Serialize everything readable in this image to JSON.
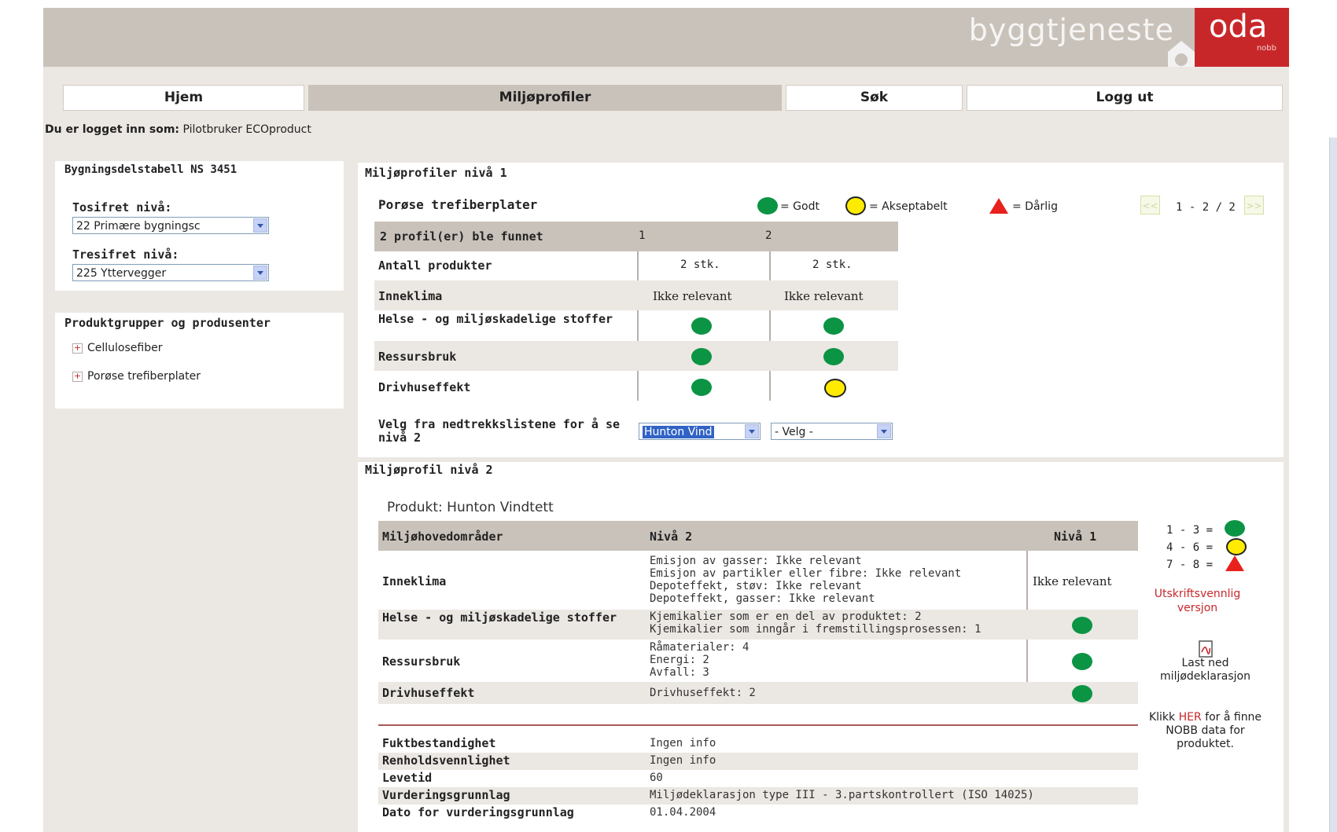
{
  "header": {
    "brand_text": "byggtjeneste",
    "logo_main": "oda",
    "logo_sub": "nobb"
  },
  "nav": {
    "items": [
      "Hjem",
      "Miljøprofiler",
      "Søk",
      "Logg ut"
    ]
  },
  "login": {
    "label": "Du er logget inn som:",
    "user": "Pilotbruker ECOproduct"
  },
  "left": {
    "ns_title": "Bygningsdelstabell NS 3451",
    "tosifret_label": "Tosifret nivå:",
    "tosifret_value": "22 Primære bygningsc",
    "tresifret_label": "Tresifret nivå:",
    "tresifret_value": "225 Yttervegger",
    "produkt_title": "Produktgrupper og produsenter",
    "groups": [
      "Cellulosefiber",
      "Porøse trefiberplater"
    ]
  },
  "level1": {
    "title": "Miljøprofiler nivå 1",
    "group_name": "Porøse trefiberplater",
    "legend": {
      "good": "= Godt",
      "ok": "= Akseptabelt",
      "bad": "= Dårlig"
    },
    "pagination": {
      "prev": "<<",
      "text": "1 - 2 / 2",
      "next": ">>"
    },
    "table": {
      "header": [
        "2 profil(er) ble funnet",
        "1",
        "2"
      ],
      "rows": [
        {
          "label": "Antall produkter",
          "c1": "2 stk.",
          "c2": "2 stk."
        },
        {
          "label": "Inneklima",
          "c1": "Ikke relevant",
          "c2": "Ikke relevant"
        },
        {
          "label": "Helse - og miljøskadelige stoffer",
          "c1": "green",
          "c2": "green"
        },
        {
          "label": "Ressursbruk",
          "c1": "green",
          "c2": "green"
        },
        {
          "label": "Drivhuseffekt",
          "c1": "green",
          "c2": "yellow"
        }
      ]
    },
    "select_label": "Velg fra nedtrekkslistene for å se nivå 2",
    "select1": "Hunton Vind",
    "select2": "- Velg -"
  },
  "level2": {
    "title": "Miljøprofil nivå 2",
    "product": "Produkt: Hunton Vindtett",
    "table": {
      "header": [
        "Miljøhovedområder",
        "Nivå 2",
        "Nivå 1"
      ],
      "rows": [
        {
          "label": "Inneklima",
          "details": [
            "Emisjon av gasser: Ikke relevant",
            "Emisjon av partikler eller fibre: Ikke relevant",
            "Depoteffekt, støv: Ikke relevant",
            "Depoteffekt, gasser: Ikke relevant"
          ],
          "level1": "Ikke relevant"
        },
        {
          "label": "Helse - og miljøskadelige stoffer",
          "details": [
            "Kjemikalier som er en del av produktet: 2",
            "Kjemikalier som inngår i fremstillingsprosessen: 1"
          ],
          "level1": "green"
        },
        {
          "label": "Ressursbruk",
          "details": [
            "Råmaterialer: 4",
            "Energi: 2",
            "Avfall: 3"
          ],
          "level1": "green"
        },
        {
          "label": "Drivhuseffekt",
          "details": [
            "Drivhuseffekt: 2"
          ],
          "level1": "green"
        }
      ]
    },
    "extra": [
      {
        "label": "Fuktbestandighet",
        "value": "Ingen info"
      },
      {
        "label": "Renholdsvennlighet",
        "value": "Ingen info"
      },
      {
        "label": "Levetid",
        "value": "60"
      },
      {
        "label": "Vurderingsgrunnlag",
        "value": "Miljødeklarasjon type III - 3.partskontrollert (ISO 14025)"
      },
      {
        "label": "Dato for vurderingsgrunnlag",
        "value": "01.04.2004"
      }
    ],
    "side": {
      "scale1": "1 - 3 =",
      "scale2": "4 - 6 =",
      "scale3": "7 - 8 =",
      "print_link": "Utskriftsvennlig versjon",
      "download_line1": "Last ned",
      "download_line2": "miljødeklarasjon",
      "klikk": "Klikk",
      "her": "HER",
      "klikk_rest": "for å finne NOBB data for produktet."
    }
  },
  "colors": {
    "green": "#0b9444",
    "yellow": "#ffeb00",
    "red": "#e8211d",
    "brand_red": "#c8272a",
    "header_bg": "#c9c2bb"
  }
}
